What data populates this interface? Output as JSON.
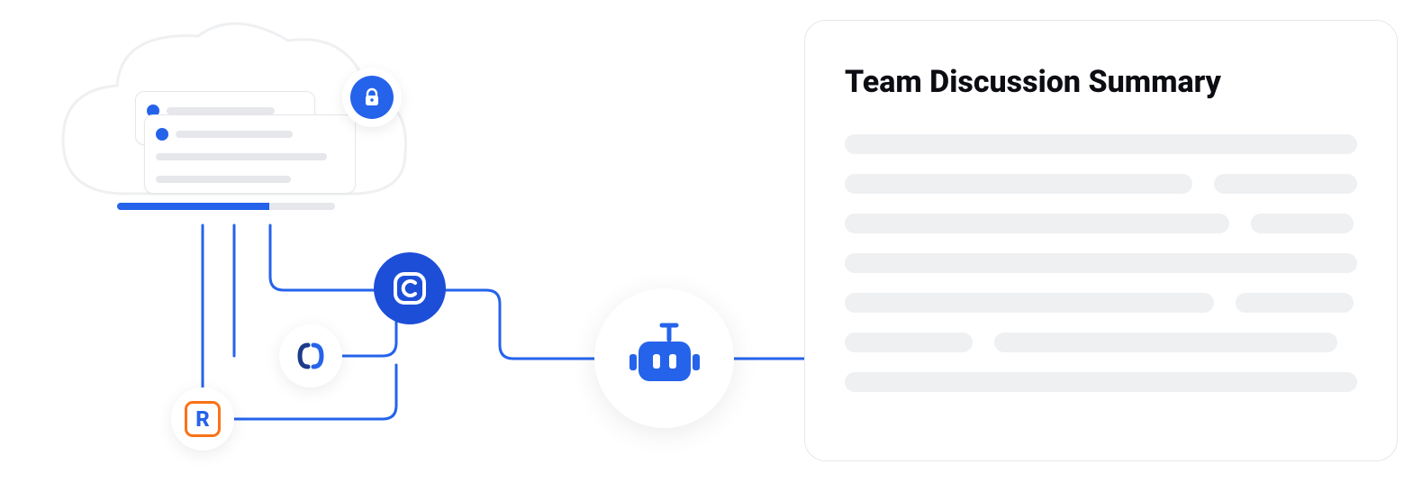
{
  "summary": {
    "title": "Team Discussion Summary"
  },
  "icons": {
    "lock": "lock-icon",
    "bot": "bot-icon",
    "c_app": "c-app-icon",
    "json_app": "json-app-icon",
    "r_app": "R"
  },
  "colors": {
    "brand_blue": "#2563eb",
    "deep_blue": "#1d4ed8",
    "orange": "#f97316",
    "placeholder_gray": "#eef0f2"
  },
  "progress_ratio": 0.7,
  "placeholder_rows": [
    [
      100
    ],
    [
      68,
      28
    ],
    [
      75,
      20
    ],
    [
      100
    ],
    [
      72,
      23
    ],
    [
      25,
      67
    ],
    [
      100
    ]
  ]
}
